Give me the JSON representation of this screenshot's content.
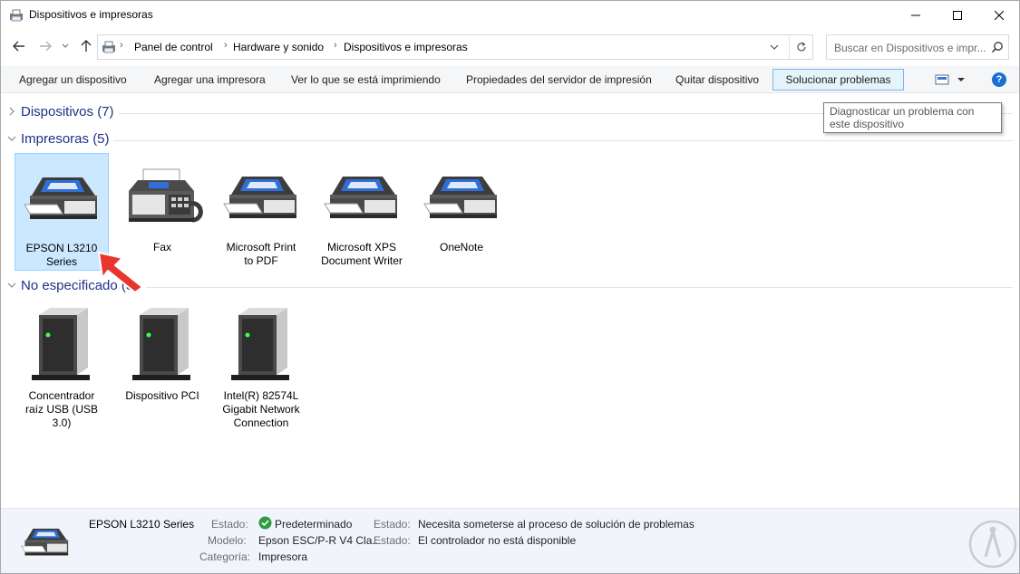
{
  "window": {
    "title": "Dispositivos e impresoras",
    "minimize_icon": "minimize-icon",
    "maximize_icon": "maximize-icon",
    "close_icon": "close-icon"
  },
  "nav": {
    "back_icon": "back-arrow-icon",
    "forward_icon": "forward-arrow-icon",
    "recent_icon": "chevron-down-icon",
    "up_icon": "up-arrow-icon"
  },
  "breadcrumb": [
    "Panel de control",
    "Hardware y sonido",
    "Dispositivos e impresoras"
  ],
  "search": {
    "placeholder": "Buscar en Dispositivos e impr..."
  },
  "commands": [
    "Agregar un dispositivo",
    "Agregar una impresora",
    "Ver lo que se está imprimiendo",
    "Propiedades del servidor de impresión",
    "Quitar dispositivo",
    "Solucionar problemas"
  ],
  "active_command_index": 5,
  "help_label": "?",
  "tooltip": "Diagnosticar un problema con este dispositivo",
  "groups": {
    "dispositivos": {
      "title": "Dispositivos (7)",
      "expanded": false
    },
    "impresoras": {
      "title": "Impresoras (5)",
      "expanded": true,
      "items": [
        {
          "line1": "EPSON L3210",
          "line2": "Series",
          "icon": "printer-icon",
          "selected": true
        },
        {
          "line1": "Fax",
          "line2": "",
          "icon": "fax-icon",
          "selected": false
        },
        {
          "line1": "Microsoft Print",
          "line2": "to PDF",
          "icon": "printer-icon",
          "selected": false
        },
        {
          "line1": "Microsoft XPS",
          "line2": "Document Writer",
          "icon": "printer-icon",
          "selected": false
        },
        {
          "line1": "OneNote",
          "line2": "",
          "icon": "printer-icon",
          "selected": false
        }
      ]
    },
    "no_especificado": {
      "title": "No especificado (3)",
      "expanded": true,
      "items": [
        {
          "line1": "Concentrador",
          "line2": "raíz USB (USB 3.0)",
          "line3": "",
          "icon": "server-tower-icon"
        },
        {
          "line1": "Dispositivo PCI",
          "line2": "",
          "line3": "",
          "icon": "server-tower-icon"
        },
        {
          "line1": "Intel(R) 82574L",
          "line2": "Gigabit Network",
          "line3": "Connection",
          "icon": "server-tower-icon"
        }
      ]
    }
  },
  "details": {
    "name": "EPSON L3210 Series",
    "estado_label": "Estado:",
    "estado_value": "Predeterminado",
    "modelo_label": "Modelo:",
    "modelo_value": "Epson ESC/P-R V4 Cla...",
    "categoria_label": "Categoría:",
    "categoria_value": "Impresora",
    "estado2_label": "Estado:",
    "estado2_value": "Necesita someterse al proceso de solución de problemas",
    "estado3_label": "Estado:",
    "estado3_value": "El controlador no está disponible"
  },
  "colors": {
    "group_title": "#1e3287",
    "selection_bg": "#cce8ff",
    "active_command_bg": "#e5f3fb",
    "details_bg": "#f1f5fb",
    "annotation_arrow": "#e8352e"
  }
}
